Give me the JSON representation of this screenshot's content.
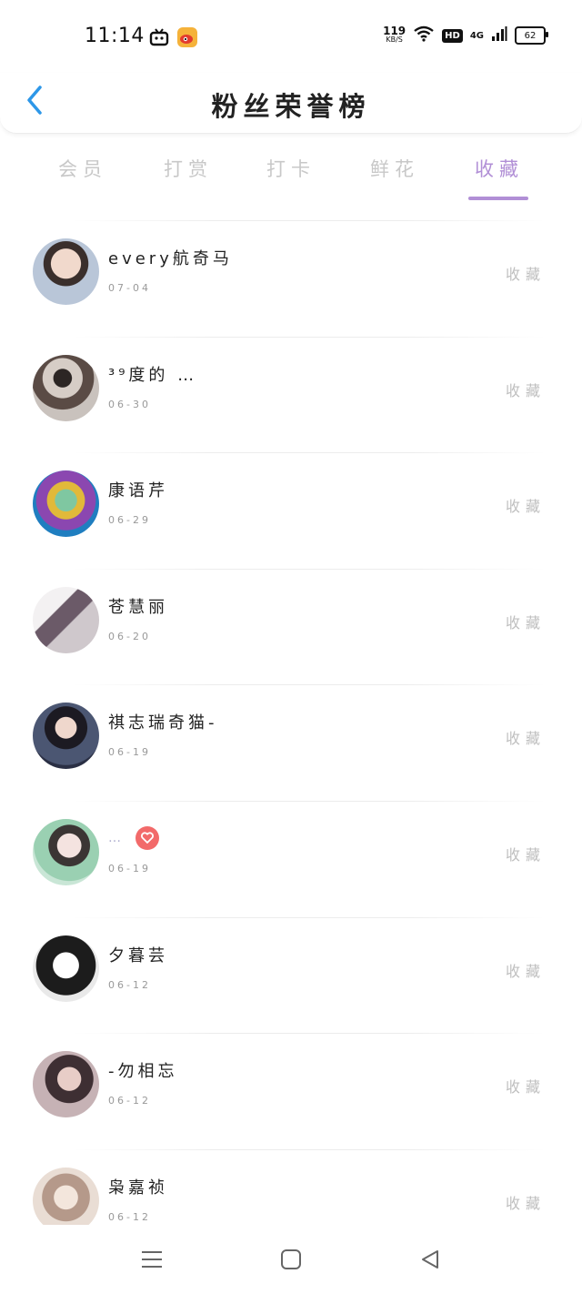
{
  "status_bar": {
    "time": "11:14",
    "net_speed": "119",
    "net_speed_unit": "KB/S",
    "hd": "HD",
    "network": "4G",
    "battery": "62"
  },
  "header": {
    "title": "粉丝荣誉榜"
  },
  "tabs": [
    {
      "label": "会员",
      "active": false
    },
    {
      "label": "打赏",
      "active": false
    },
    {
      "label": "打卡",
      "active": false
    },
    {
      "label": "鲜花",
      "active": false
    },
    {
      "label": "收藏",
      "active": true
    }
  ],
  "accent_color": "#b18fd6",
  "fans": [
    {
      "name": "every航奇马",
      "date": "07-04",
      "action": "收藏"
    },
    {
      "name": "³⁹度的 …",
      "date": "06-30",
      "action": "收藏"
    },
    {
      "name": "康语芹",
      "date": "06-29",
      "action": "收藏"
    },
    {
      "name": "苍慧丽",
      "date": "06-20",
      "action": "收藏"
    },
    {
      "name": "祺志瑞奇猫-",
      "date": "06-19",
      "action": "收藏"
    },
    {
      "name": "…",
      "date": "06-19",
      "action": "收藏",
      "badge": "heart-icon"
    },
    {
      "name": "夕暮芸",
      "date": "06-12",
      "action": "收藏"
    },
    {
      "name": "-勿相忘",
      "date": "06-12",
      "action": "收藏"
    },
    {
      "name": "枭嘉祯",
      "date": "06-12",
      "action": "收藏"
    }
  ]
}
